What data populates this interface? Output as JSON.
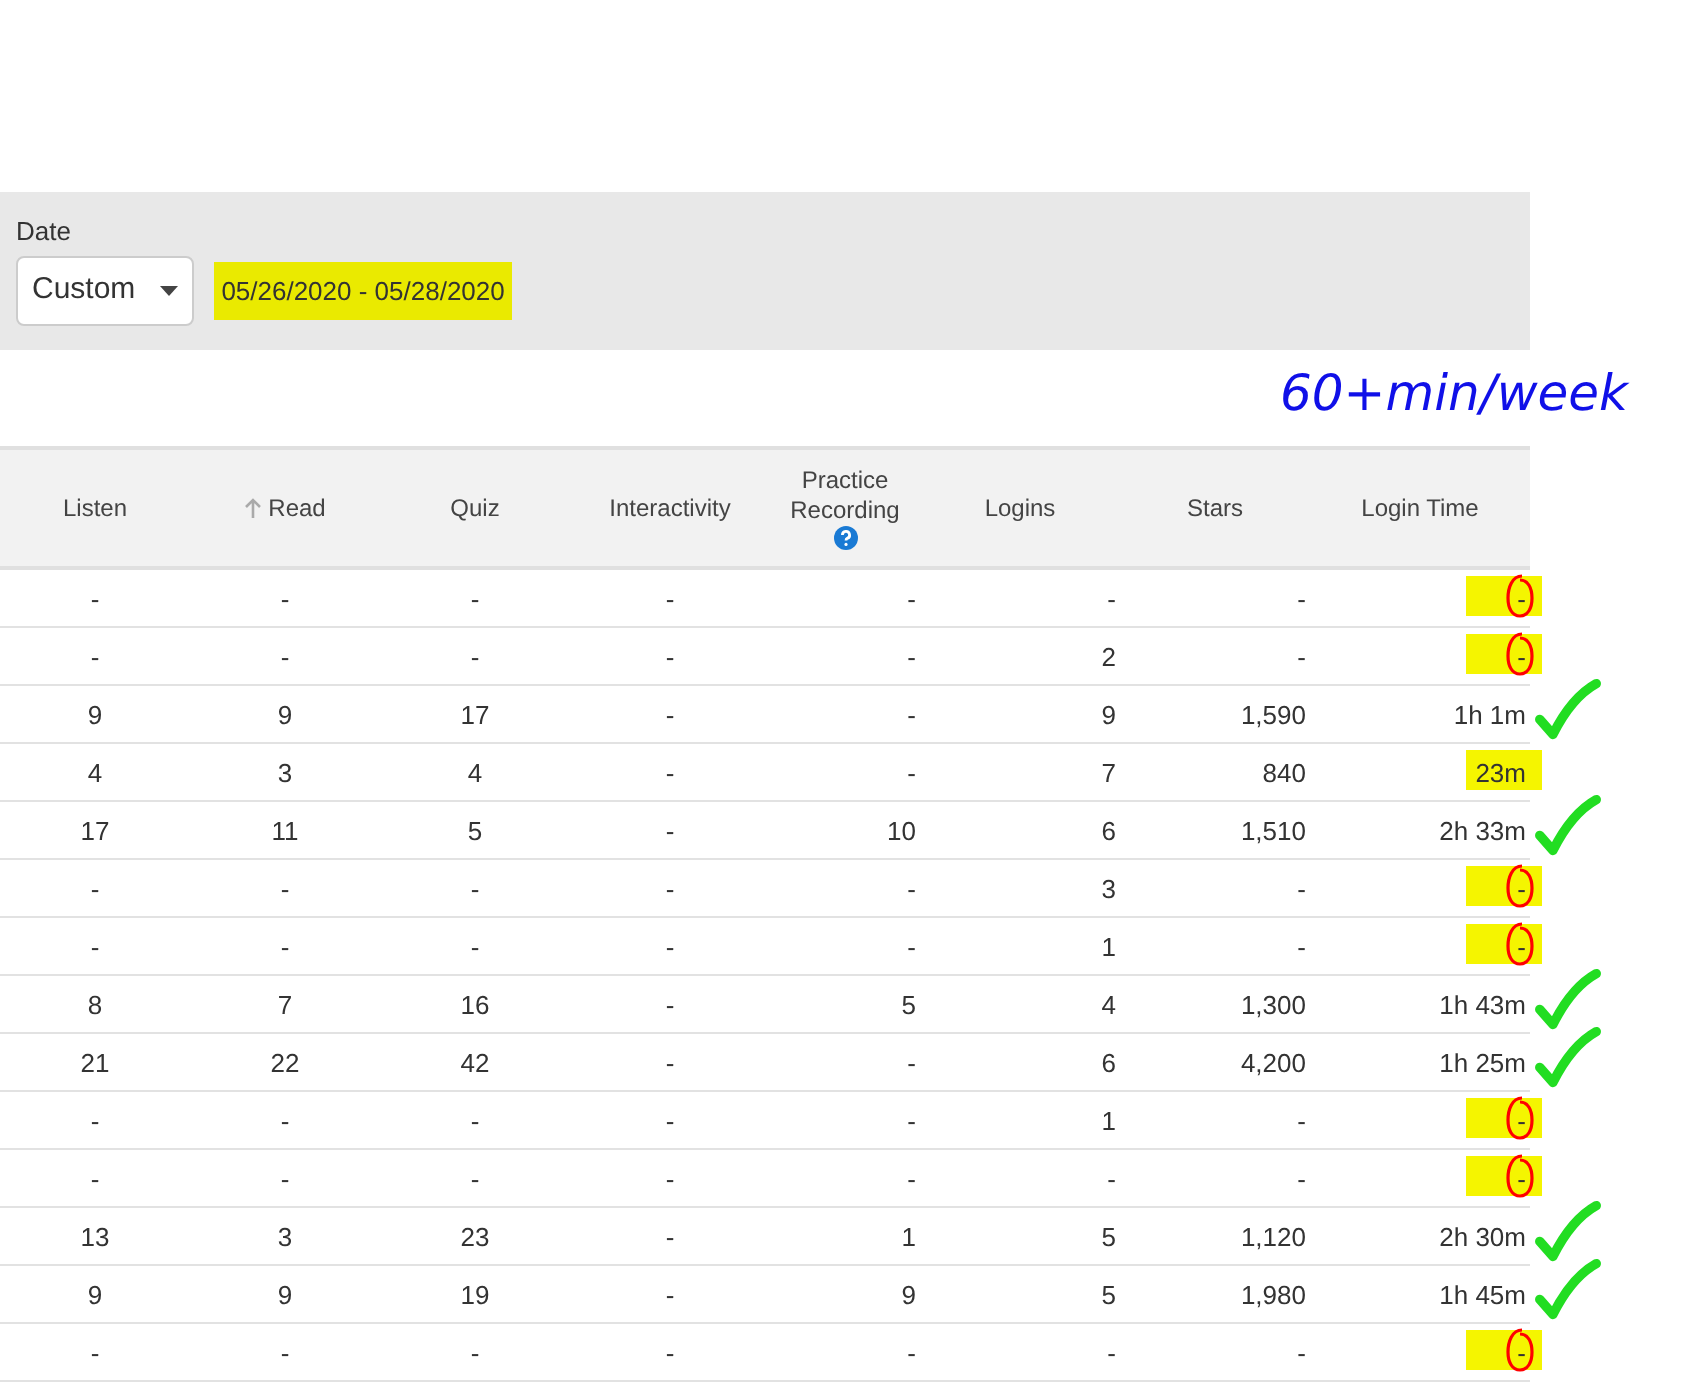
{
  "filter": {
    "label": "Date",
    "dropdown": {
      "value": "Custom"
    },
    "date_range": {
      "text": "05/26/2020 - 05/28/2020",
      "highlighted": true
    }
  },
  "note": "60+min/week",
  "table": {
    "columns": [
      {
        "label": "Listen",
        "sorted": false,
        "help": false
      },
      {
        "label": "Read",
        "sorted": true,
        "help": false
      },
      {
        "label": "Quiz",
        "sorted": false,
        "help": false
      },
      {
        "label": "Interactivity",
        "sorted": false,
        "help": false
      },
      {
        "label": "Practice Recording",
        "sorted": false,
        "help": true
      },
      {
        "label": "Logins",
        "sorted": false,
        "help": false
      },
      {
        "label": "Stars",
        "sorted": false,
        "help": false
      },
      {
        "label": "Login Time",
        "sorted": false,
        "help": false
      }
    ],
    "rows": [
      {
        "cells": [
          "-",
          "-",
          "-",
          "-",
          "-",
          "-",
          "-",
          "-"
        ],
        "highlighted": true,
        "circled": true,
        "checked": false
      },
      {
        "cells": [
          "-",
          "-",
          "-",
          "-",
          "-",
          "2",
          "-",
          "-"
        ],
        "highlighted": true,
        "circled": true,
        "checked": false
      },
      {
        "cells": [
          "9",
          "9",
          "17",
          "-",
          "-",
          "9",
          "1,590",
          "1h 1m"
        ],
        "highlighted": false,
        "circled": false,
        "checked": true
      },
      {
        "cells": [
          "4",
          "3",
          "4",
          "-",
          "-",
          "7",
          "840",
          "23m"
        ],
        "highlighted": true,
        "circled": false,
        "checked": false
      },
      {
        "cells": [
          "17",
          "11",
          "5",
          "-",
          "10",
          "6",
          "1,510",
          "2h 33m"
        ],
        "highlighted": false,
        "circled": false,
        "checked": true
      },
      {
        "cells": [
          "-",
          "-",
          "-",
          "-",
          "-",
          "3",
          "-",
          "-"
        ],
        "highlighted": true,
        "circled": true,
        "checked": false
      },
      {
        "cells": [
          "-",
          "-",
          "-",
          "-",
          "-",
          "1",
          "-",
          "-"
        ],
        "highlighted": true,
        "circled": true,
        "checked": false
      },
      {
        "cells": [
          "8",
          "7",
          "16",
          "-",
          "5",
          "4",
          "1,300",
          "1h 43m"
        ],
        "highlighted": false,
        "circled": false,
        "checked": true
      },
      {
        "cells": [
          "21",
          "22",
          "42",
          "-",
          "-",
          "6",
          "4,200",
          "1h 25m"
        ],
        "highlighted": false,
        "circled": false,
        "checked": true
      },
      {
        "cells": [
          "-",
          "-",
          "-",
          "-",
          "-",
          "1",
          "-",
          "-"
        ],
        "highlighted": true,
        "circled": true,
        "checked": false
      },
      {
        "cells": [
          "-",
          "-",
          "-",
          "-",
          "-",
          "-",
          "-",
          "-"
        ],
        "highlighted": true,
        "circled": true,
        "checked": false
      },
      {
        "cells": [
          "13",
          "3",
          "23",
          "-",
          "1",
          "5",
          "1,120",
          "2h 30m"
        ],
        "highlighted": false,
        "circled": false,
        "checked": true
      },
      {
        "cells": [
          "9",
          "9",
          "19",
          "-",
          "9",
          "5",
          "1,980",
          "1h 45m"
        ],
        "highlighted": false,
        "circled": false,
        "checked": true
      },
      {
        "cells": [
          "-",
          "-",
          "-",
          "-",
          "-",
          "-",
          "-",
          "-"
        ],
        "highlighted": true,
        "circled": true,
        "checked": false
      }
    ]
  }
}
